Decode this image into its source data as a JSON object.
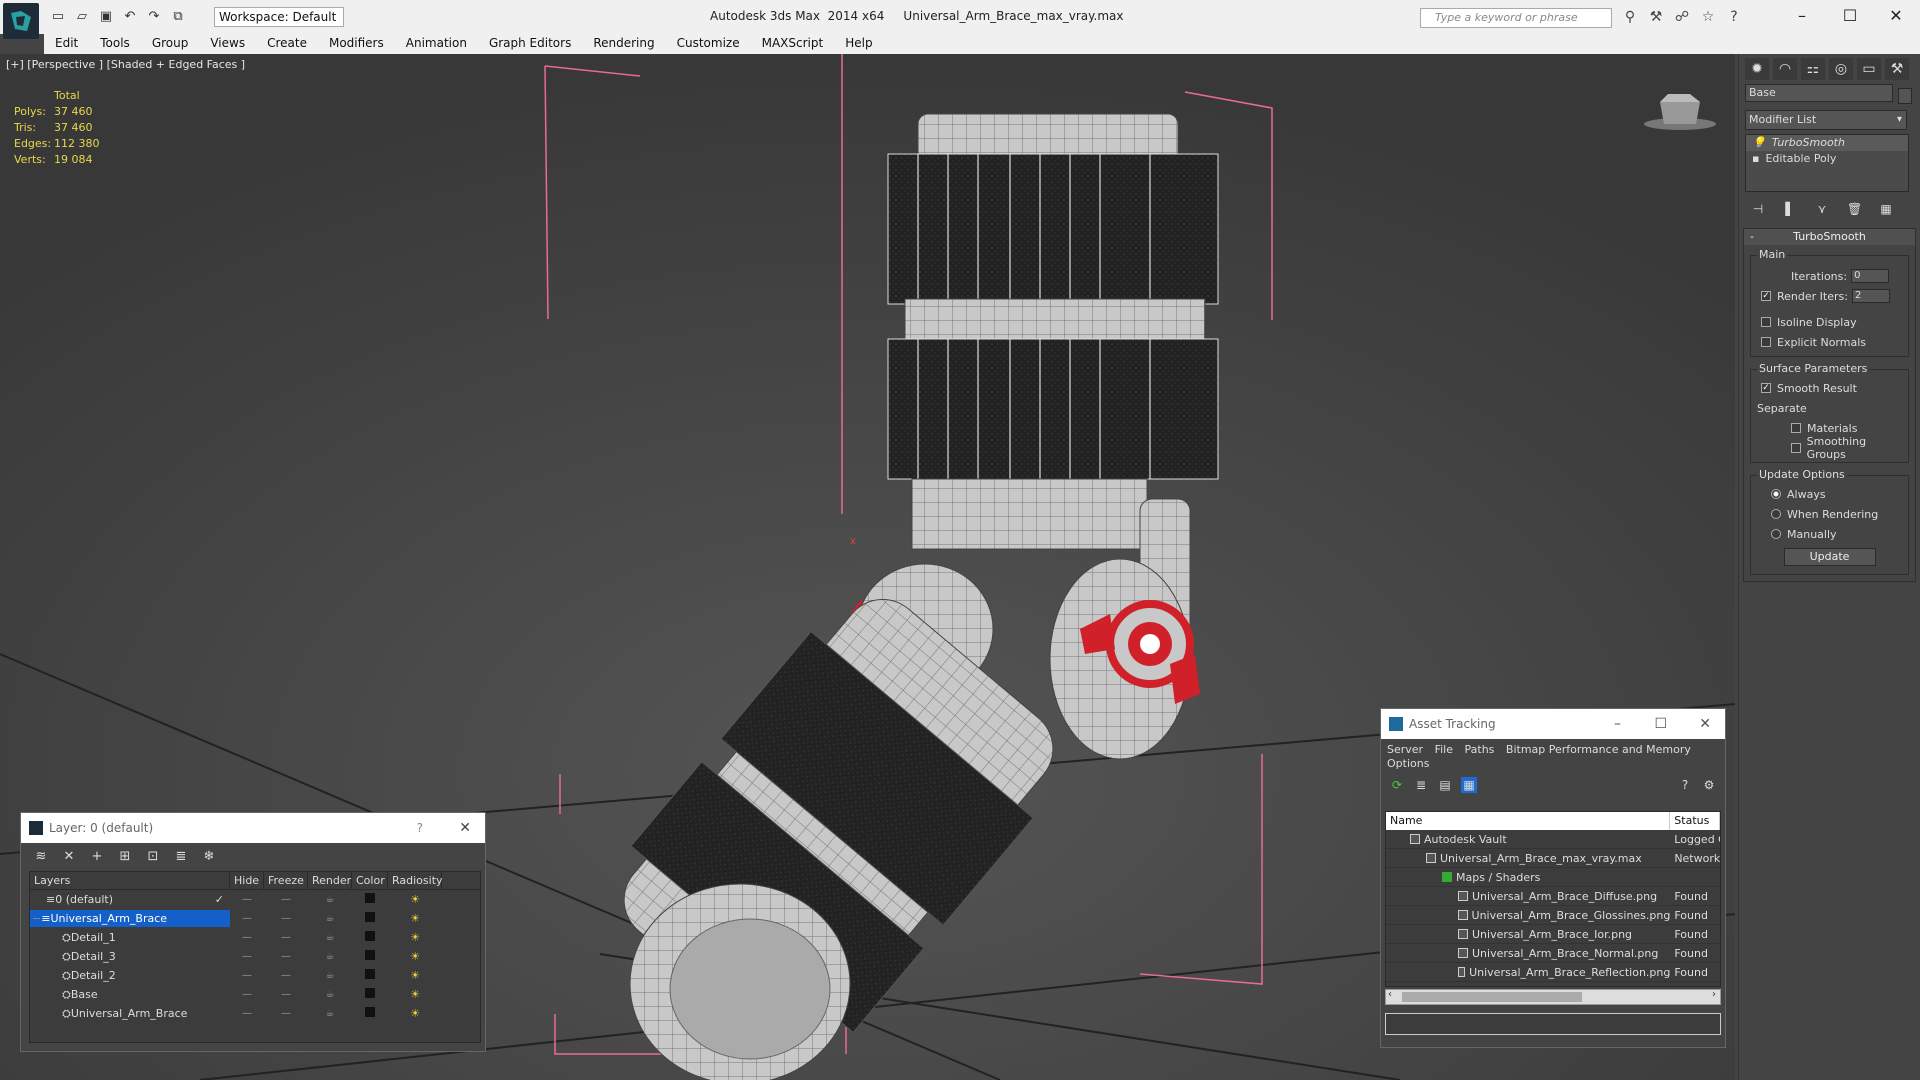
{
  "titlebar": {
    "app_title": "Autodesk 3ds Max  2014 x64     Universal_Arm_Brace_max_vray.max",
    "workspace": "Workspace: Default",
    "search_placeholder": "Type a keyword or phrase"
  },
  "menu": [
    "Edit",
    "Tools",
    "Group",
    "Views",
    "Create",
    "Modifiers",
    "Animation",
    "Graph Editors",
    "Rendering",
    "Customize",
    "MAXScript",
    "Help"
  ],
  "viewport": {
    "label": "[+] [Perspective ] [Shaded + Edged Faces ]",
    "stats": {
      "header": "Total",
      "rows": [
        {
          "k": "Polys:",
          "v": "37 460"
        },
        {
          "k": "Tris:",
          "v": "37 460"
        },
        {
          "k": "Edges:",
          "v": "112 380"
        },
        {
          "k": "Verts:",
          "v": "19 084"
        }
      ]
    }
  },
  "command_panel": {
    "object_name": "Base",
    "modifier_list": "Modifier List",
    "stack": [
      "TurboSmooth",
      "Editable Poly"
    ],
    "rollout_title": "TurboSmooth",
    "main_label": "Main",
    "iterations_label": "Iterations:",
    "iterations": "0",
    "render_iters_label": "Render Iters:",
    "render_iters": "2",
    "isoline": "Isoline Display",
    "explicit_normals": "Explicit Normals",
    "surface_params": "Surface Parameters",
    "smooth_result": "Smooth Result",
    "separate": "Separate",
    "materials": "Materials",
    "smoothing_groups": "Smoothing Groups",
    "update_options": "Update Options",
    "always": "Always",
    "when_rendering": "When Rendering",
    "manually": "Manually",
    "update_button": "Update"
  },
  "layer_window": {
    "title": "Layer: 0 (default)",
    "help": "?",
    "columns": [
      "Layers",
      "Hide",
      "Freeze",
      "Render",
      "Color",
      "Radiosity"
    ],
    "rows": [
      {
        "name": "0 (default)",
        "indent": 0,
        "selected": false
      },
      {
        "name": "Universal_Arm_Brace",
        "indent": 0,
        "selected": true
      },
      {
        "name": "Detail_1",
        "indent": 1,
        "selected": false
      },
      {
        "name": "Detail_3",
        "indent": 1,
        "selected": false
      },
      {
        "name": "Detail_2",
        "indent": 1,
        "selected": false
      },
      {
        "name": "Base",
        "indent": 1,
        "selected": false
      },
      {
        "name": "Universal_Arm_Brace",
        "indent": 1,
        "selected": false
      }
    ]
  },
  "asset_window": {
    "title": "Asset Tracking",
    "menu": [
      "Server",
      "File",
      "Paths",
      "Bitmap Performance and Memory",
      "Options"
    ],
    "columns": [
      "Name",
      "Status"
    ],
    "rows": [
      {
        "name": "Autodesk Vault",
        "status": "Logged O",
        "indent": 1
      },
      {
        "name": "Universal_Arm_Brace_max_vray.max",
        "status": "Network",
        "indent": 2
      },
      {
        "name": "Maps / Shaders",
        "status": "",
        "indent": 3
      },
      {
        "name": "Universal_Arm_Brace_Diffuse.png",
        "status": "Found",
        "indent": 4
      },
      {
        "name": "Universal_Arm_Brace_Glossines.png",
        "status": "Found",
        "indent": 4
      },
      {
        "name": "Universal_Arm_Brace_Ior.png",
        "status": "Found",
        "indent": 4
      },
      {
        "name": "Universal_Arm_Brace_Normal.png",
        "status": "Found",
        "indent": 4
      },
      {
        "name": "Universal_Arm_Brace_Reflection.png",
        "status": "Found",
        "indent": 4
      }
    ]
  }
}
